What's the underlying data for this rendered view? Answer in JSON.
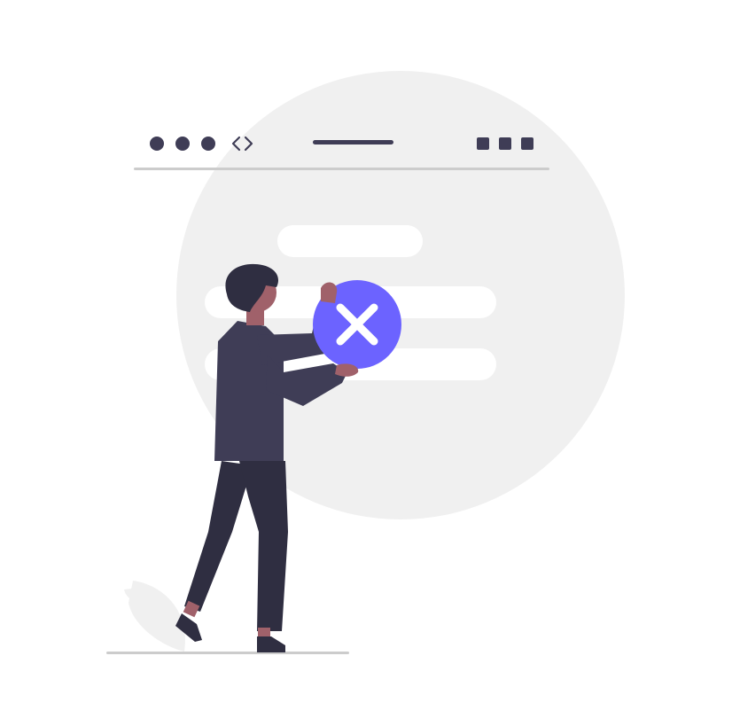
{
  "illustration": {
    "theme": "error / failed action",
    "colors": {
      "background": "#ffffff",
      "circle_bg": "#f0f0f0",
      "placeholder_bar": "#ffffff",
      "browser_line": "#cccccc",
      "dark": "#3f3d56",
      "pants": "#2f2e41",
      "skin": "#a0616a",
      "accent": "#6c63ff",
      "icon_fg": "#ffffff",
      "ground": "#cccccc",
      "leaf": "#f0f0f0"
    },
    "browser_bar": {
      "window_dots": 3,
      "nav_icon": "chevron-left-right-icon",
      "window_buttons": 3
    },
    "status_icon": "close-x-icon",
    "placeholder_rows": 3
  }
}
